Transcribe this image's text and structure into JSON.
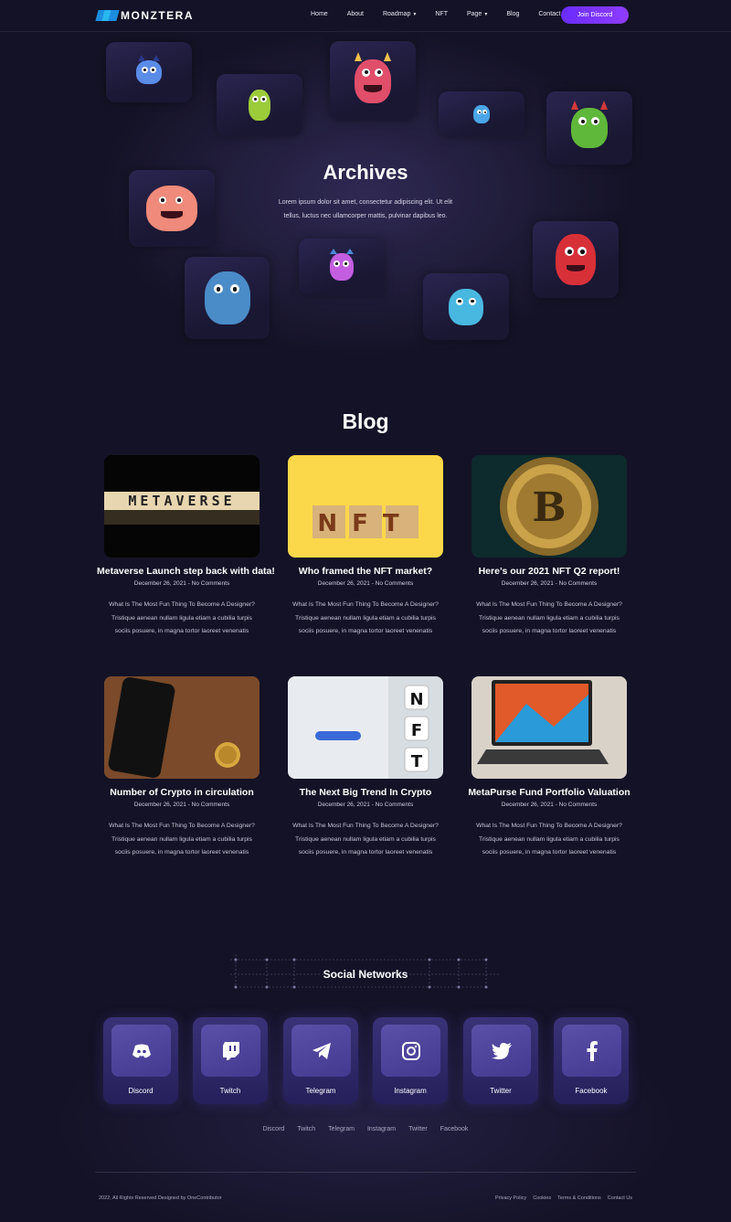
{
  "brand": {
    "name": "MONZTERA"
  },
  "nav": {
    "items": [
      {
        "label": "Home",
        "has_dropdown": false
      },
      {
        "label": "About",
        "has_dropdown": false
      },
      {
        "label": "Roadmap",
        "has_dropdown": true
      },
      {
        "label": "NFT",
        "has_dropdown": false
      },
      {
        "label": "Page",
        "has_dropdown": true
      },
      {
        "label": "Blog",
        "has_dropdown": false
      },
      {
        "label": "Contact",
        "has_dropdown": false
      }
    ],
    "cta_label": "Join Discord"
  },
  "hero": {
    "title": "Archives",
    "subtitle_line1": "Lorem ipsum dolor sit amet, consectetur adipiscing elit. Ut elit",
    "subtitle_line2": "tellus, luctus nec ullamcorper mattis, pulvinar dapibus leo."
  },
  "blog": {
    "title": "Blog",
    "posts": [
      {
        "title": "Metaverse Launch step back with data!",
        "date": "December 26, 2021",
        "comments": "No Comments",
        "excerpt_line1": "What Is The Most Fun Thing To Become A Designer?",
        "excerpt_line2": "Tristique aenean nullam ligula etiam a cubilia turpis",
        "excerpt_line3": "sociis posuere, in magna tortor laoreet venenatis"
      },
      {
        "title": "Who framed the NFT market?",
        "date": "December 26, 2021",
        "comments": "No Comments",
        "excerpt_line1": "What Is The Most Fun Thing To Become A Designer?",
        "excerpt_line2": "Tristique aenean nullam ligula etiam a cubilia turpis",
        "excerpt_line3": "sociis posuere, in magna tortor laoreet venenatis"
      },
      {
        "title": "Here’s our 2021 NFT Q2 report!",
        "date": "December 26, 2021",
        "comments": "No Comments",
        "excerpt_line1": "What Is The Most Fun Thing To Become A Designer?",
        "excerpt_line2": "Tristique aenean nullam ligula etiam a cubilia turpis",
        "excerpt_line3": "sociis posuere, in magna tortor laoreet venenatis"
      },
      {
        "title": "Number of Crypto in circulation",
        "date": "December 26, 2021",
        "comments": "No Comments",
        "excerpt_line1": "What Is The Most Fun Thing To Become A Designer?",
        "excerpt_line2": "Tristique aenean nullam ligula etiam a cubilia turpis",
        "excerpt_line3": "sociis posuere, in magna tortor laoreet venenatis"
      },
      {
        "title": "The Next Big Trend In Crypto",
        "date": "December 26, 2021",
        "comments": "No Comments",
        "excerpt_line1": "What Is The Most Fun Thing To Become A Designer?",
        "excerpt_line2": "Tristique aenean nullam ligula etiam a cubilia turpis",
        "excerpt_line3": "sociis posuere, in magna tortor laoreet venenatis"
      },
      {
        "title": "MetaPurse Fund Portfolio Valuation",
        "date": "December 26, 2021",
        "comments": "No Comments",
        "excerpt_line1": "What Is The Most Fun Thing To Become A Designer?",
        "excerpt_line2": "Tristique aenean nullam ligula etiam a cubilia turpis",
        "excerpt_line3": "sociis posuere, in magna tortor laoreet venenatis"
      }
    ],
    "image_texts": {
      "metaverse": "METAVERSE",
      "nft": "NFT",
      "bitcoin": "B",
      "nft_vertical": [
        "N",
        "F",
        "T"
      ]
    }
  },
  "social": {
    "title": "Social Networks",
    "cards": [
      {
        "label": "Discord",
        "icon": "discord-icon"
      },
      {
        "label": "Twitch",
        "icon": "twitch-icon"
      },
      {
        "label": "Telegram",
        "icon": "telegram-icon"
      },
      {
        "label": "Instagram",
        "icon": "instagram-icon"
      },
      {
        "label": "Twitter",
        "icon": "twitter-icon"
      },
      {
        "label": "Facebook",
        "icon": "facebook-icon"
      }
    ],
    "links": [
      "Discord",
      "Twitch",
      "Telegram",
      "Instagram",
      "Twitter",
      "Facebook"
    ]
  },
  "footer": {
    "copyright": "2022, All Rights Reserved Designed by OneContributor",
    "links": [
      "Privacy Policy",
      "Cookies",
      "Terms & Conditions",
      "Contact Us"
    ]
  },
  "colors": {
    "background": "#141226",
    "accent": "#7a33ff",
    "card": "#2a2550",
    "social_card": "#3a3278"
  }
}
